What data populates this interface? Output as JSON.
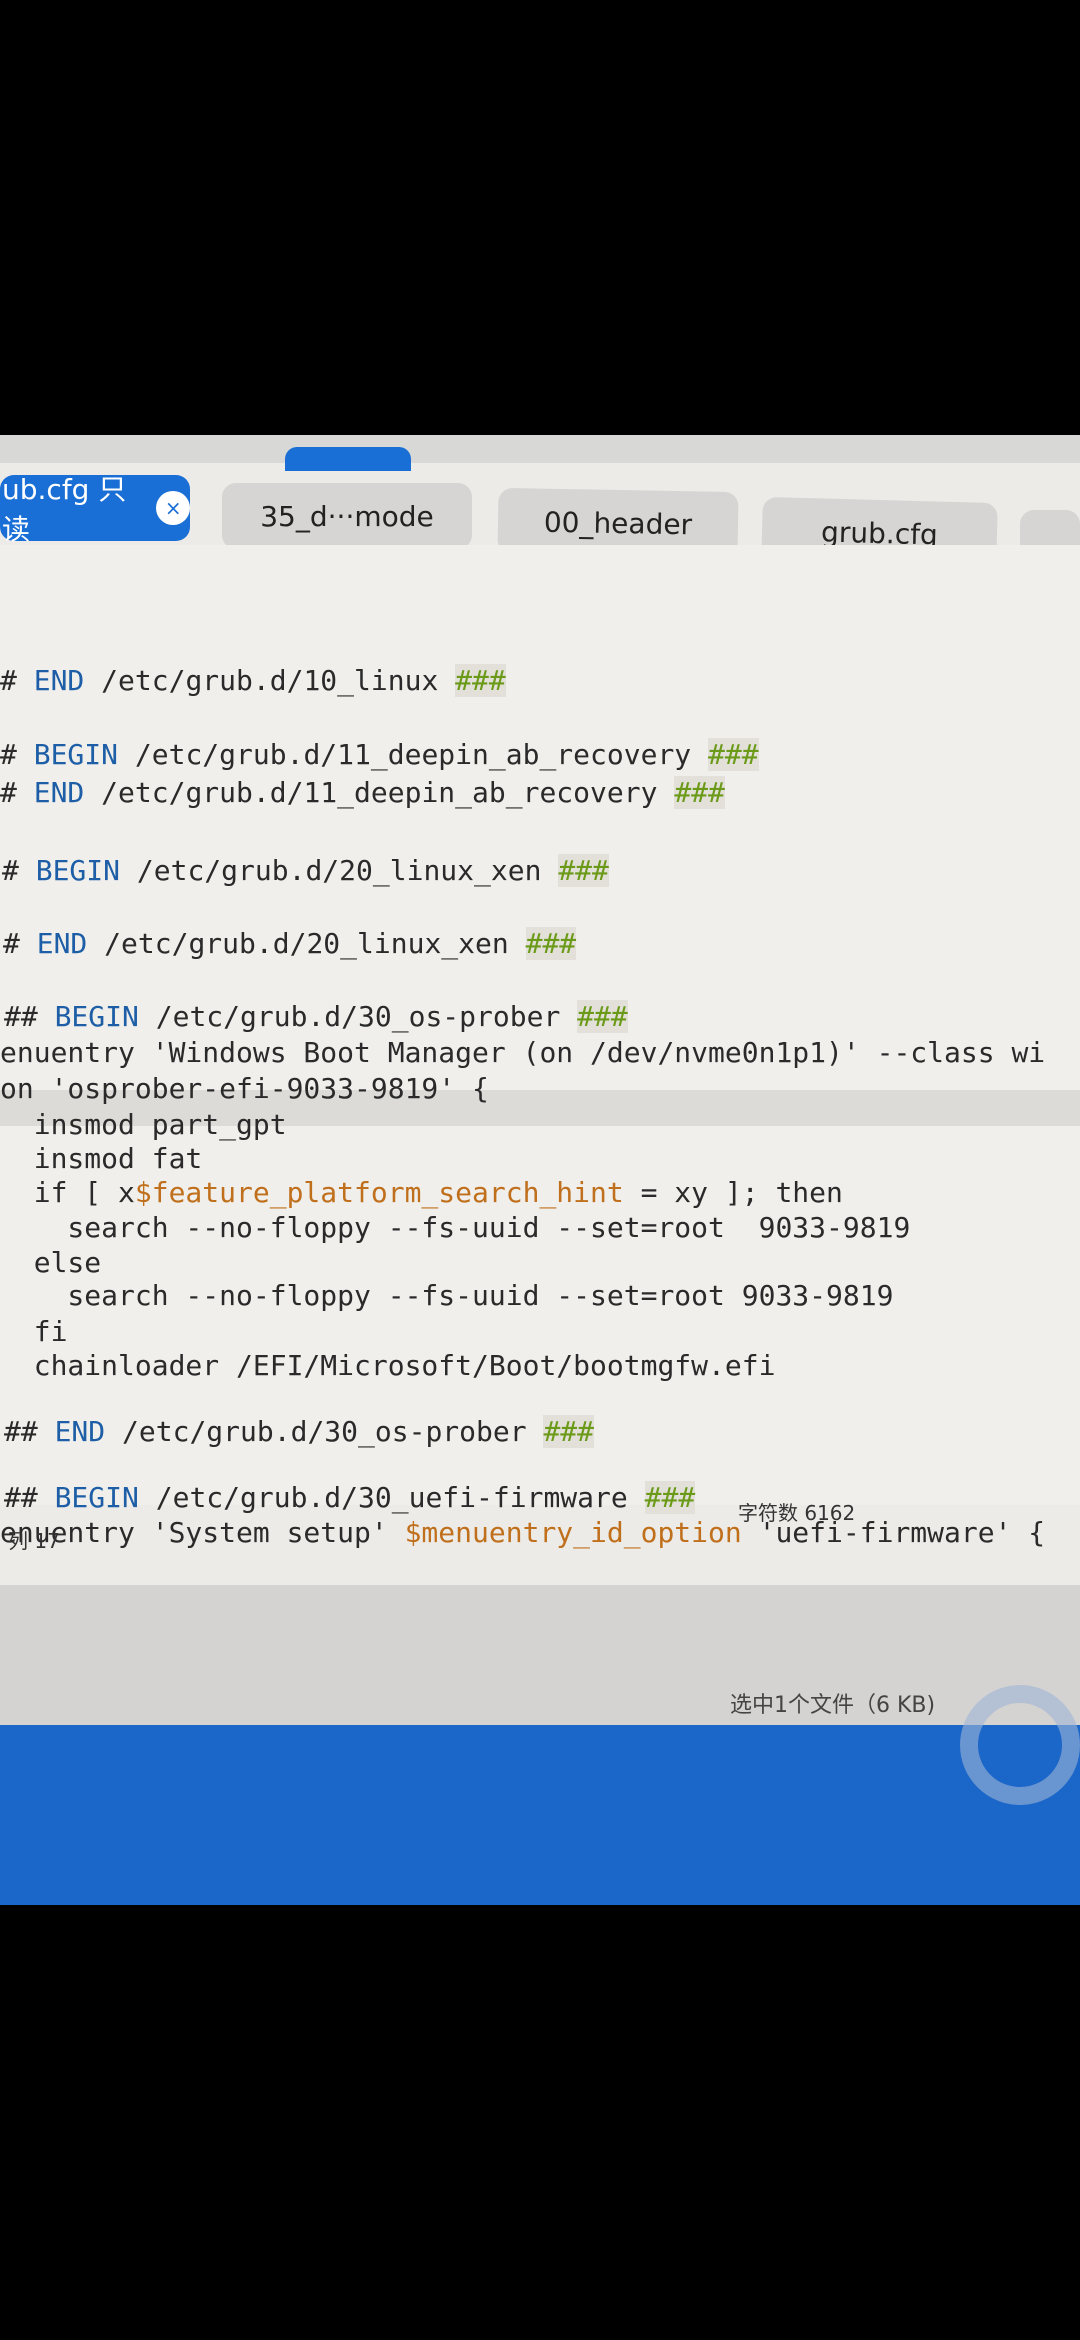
{
  "tabs": [
    {
      "label": "ub.cfg  只读",
      "active": true,
      "close": "×"
    },
    {
      "label": "35_d···mode"
    },
    {
      "label": "00_header"
    },
    {
      "label": "grub.cfg"
    }
  ],
  "code_lines": [
    [
      {
        "t": "# ",
        "c": ""
      },
      {
        "t": "END",
        "c": "kw"
      },
      {
        "t": " /etc/grub.d/10_linux ",
        "c": ""
      },
      {
        "t": "###",
        "c": "hash"
      }
    ],
    [
      {
        "t": "# ",
        "c": ""
      },
      {
        "t": "BEGIN",
        "c": "kw"
      },
      {
        "t": " /etc/grub.d/11_deepin_ab_recovery ",
        "c": ""
      },
      {
        "t": "###",
        "c": "hash"
      }
    ],
    [
      {
        "t": "# ",
        "c": ""
      },
      {
        "t": "END",
        "c": "kw"
      },
      {
        "t": " /etc/grub.d/11_deepin_ab_recovery ",
        "c": ""
      },
      {
        "t": "###",
        "c": "hash"
      }
    ],
    [
      {
        "t": "# ",
        "c": ""
      },
      {
        "t": "BEGIN",
        "c": "kw"
      },
      {
        "t": " /etc/grub.d/20_linux_xen ",
        "c": ""
      },
      {
        "t": "###",
        "c": "hash"
      }
    ],
    [
      {
        "t": "# ",
        "c": ""
      },
      {
        "t": "END",
        "c": "kw"
      },
      {
        "t": " /etc/grub.d/20_linux_xen ",
        "c": ""
      },
      {
        "t": "###",
        "c": "hash"
      }
    ],
    [
      {
        "t": "## ",
        "c": ""
      },
      {
        "t": "BEGIN",
        "c": "kw"
      },
      {
        "t": " /etc/grub.d/30_os-prober ",
        "c": ""
      },
      {
        "t": "###",
        "c": "hash"
      }
    ],
    [
      {
        "t": "enuentry 'Windows Boot Manager (on /dev/nvme0n1p1)' --class wi",
        "c": ""
      }
    ],
    [
      {
        "t": "on 'osprober-efi-9033-9819' {",
        "c": ""
      }
    ],
    [
      {
        "t": "  insmod part_gpt",
        "c": ""
      }
    ],
    [
      {
        "t": "  insmod fat",
        "c": ""
      }
    ],
    [
      {
        "t": "  if [ x",
        "c": ""
      },
      {
        "t": "$feature_platform_search_hint",
        "c": "var"
      },
      {
        "t": " = xy ]; then",
        "c": ""
      }
    ],
    [
      {
        "t": "    search --no-floppy --fs-uuid --set=root  9033-9819",
        "c": ""
      }
    ],
    [
      {
        "t": "  else",
        "c": ""
      }
    ],
    [
      {
        "t": "    search --no-floppy --fs-uuid --set=root 9033-9819",
        "c": ""
      }
    ],
    [
      {
        "t": "  fi",
        "c": ""
      }
    ],
    [
      {
        "t": "  chainloader /EFI/Microsoft/Boot/bootmgfw.efi",
        "c": ""
      }
    ],
    [
      {
        "t": "## ",
        "c": ""
      },
      {
        "t": "END",
        "c": "kw"
      },
      {
        "t": " /etc/grub.d/30_os-prober ",
        "c": ""
      },
      {
        "t": "###",
        "c": "hash"
      }
    ],
    [
      {
        "t": "## ",
        "c": ""
      },
      {
        "t": "BEGIN",
        "c": "kw"
      },
      {
        "t": " /etc/grub.d/30_uefi-firmware ",
        "c": ""
      },
      {
        "t": "###",
        "c": "hash"
      }
    ],
    [
      {
        "t": "enuentry 'System setup' ",
        "c": ""
      },
      {
        "t": "$menuentry_id_option",
        "c": "var"
      },
      {
        "t": " 'uefi-firmware' {",
        "c": ""
      }
    ]
  ],
  "status": {
    "column": "列 17",
    "char_count": "字符数 6162"
  },
  "file_manager": {
    "selection": "选中1个文件（6 KB)"
  }
}
